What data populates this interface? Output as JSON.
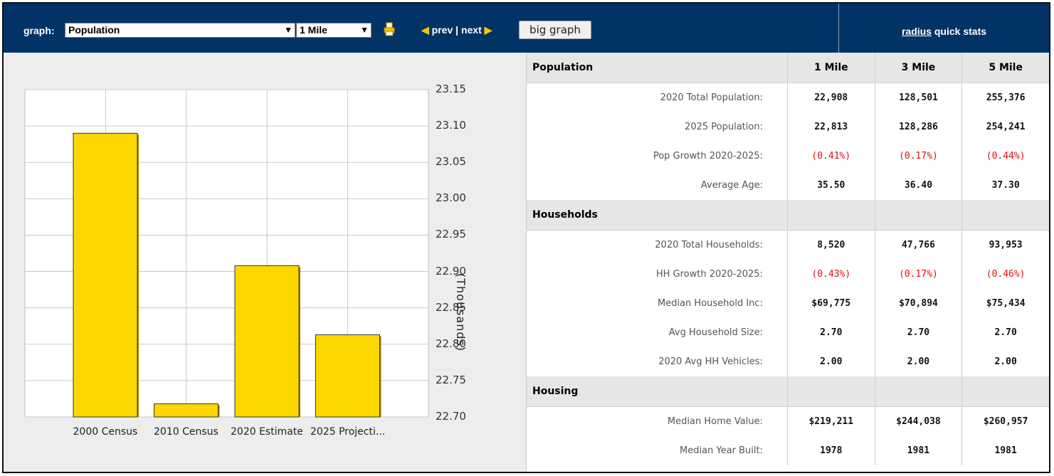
{
  "toolbar": {
    "graph_label": "graph:",
    "metric_select": "Population",
    "radius_select": "1 Mile",
    "prev": "prev",
    "divider": "|",
    "next": "next",
    "big_graph": "big graph",
    "quick_stats_link": "radius",
    "quick_stats_rest": " quick stats"
  },
  "chart_data": {
    "type": "bar",
    "categories": [
      "2000 Census",
      "2010 Census",
      "2020 Estimate",
      "2025 Projecti..."
    ],
    "values": [
      23.09,
      22.718,
      22.908,
      22.813
    ],
    "ylabel": "(Thousands)",
    "ylim": [
      22.7,
      23.15
    ],
    "yticks": [
      "23.15",
      "23.10",
      "23.05",
      "23.00",
      "22.95",
      "22.90",
      "22.85",
      "22.80",
      "22.75",
      "22.70"
    ],
    "bar_color": "#ffd700",
    "grid": true
  },
  "stats": {
    "columns": [
      "1 Mile",
      "3 Mile",
      "5 Mile"
    ],
    "sections": [
      {
        "name": "Population",
        "rows": [
          {
            "label": "2020 Total Population:",
            "values": [
              "22,908",
              "128,501",
              "255,376"
            ],
            "negative": false
          },
          {
            "label": "2025 Population:",
            "values": [
              "22,813",
              "128,286",
              "254,241"
            ],
            "negative": false
          },
          {
            "label": "Pop Growth 2020-2025:",
            "values": [
              "(0.41%)",
              "(0.17%)",
              "(0.44%)"
            ],
            "negative": true
          },
          {
            "label": "Average Age:",
            "values": [
              "35.50",
              "36.40",
              "37.30"
            ],
            "negative": false
          }
        ]
      },
      {
        "name": "Households",
        "rows": [
          {
            "label": "2020 Total Households:",
            "values": [
              "8,520",
              "47,766",
              "93,953"
            ],
            "negative": false
          },
          {
            "label": "HH Growth 2020-2025:",
            "values": [
              "(0.43%)",
              "(0.17%)",
              "(0.46%)"
            ],
            "negative": true
          },
          {
            "label": "Median Household Inc:",
            "values": [
              "$69,775",
              "$70,894",
              "$75,434"
            ],
            "negative": false
          },
          {
            "label": "Avg Household Size:",
            "values": [
              "2.70",
              "2.70",
              "2.70"
            ],
            "negative": false
          },
          {
            "label": "2020 Avg HH Vehicles:",
            "values": [
              "2.00",
              "2.00",
              "2.00"
            ],
            "negative": false
          }
        ]
      },
      {
        "name": "Housing",
        "rows": [
          {
            "label": "Median Home Value:",
            "values": [
              "$219,211",
              "$244,038",
              "$260,957"
            ],
            "negative": false
          },
          {
            "label": "Median Year Built:",
            "values": [
              "1978",
              "1981",
              "1981"
            ],
            "negative": false
          }
        ]
      }
    ]
  },
  "colors": {
    "header_bg": "#023366",
    "negative": "#dd1111",
    "accent": "#f5c400"
  },
  "icons": [
    "printer-icon",
    "prev-arrow-icon",
    "next-arrow-icon",
    "dropdown-arrow-icon"
  ]
}
